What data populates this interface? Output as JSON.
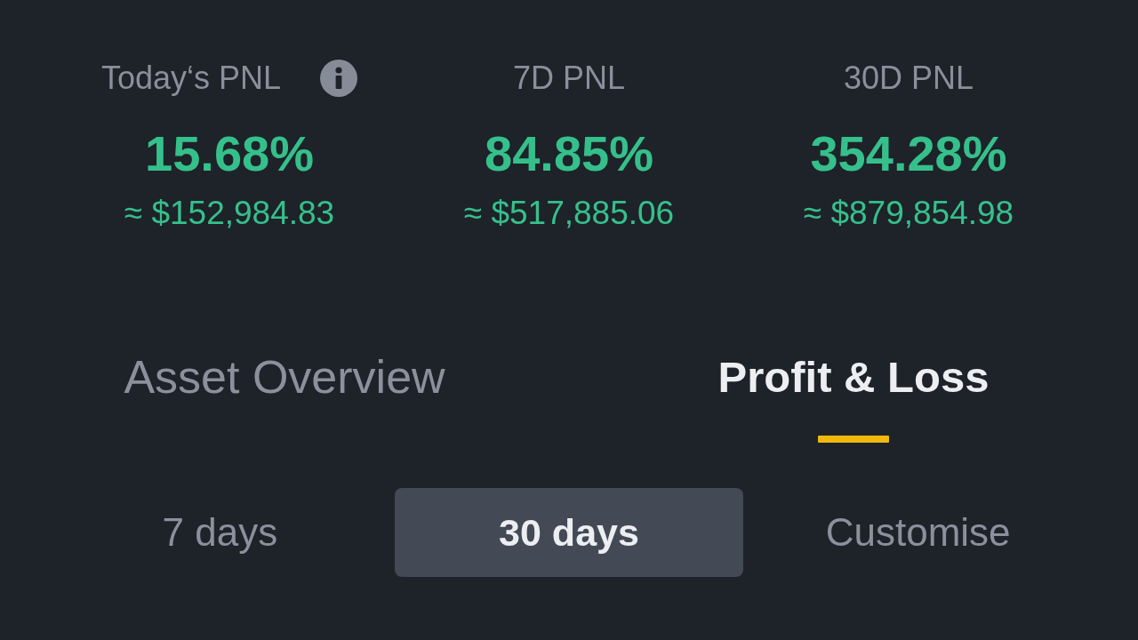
{
  "stats": [
    {
      "label": "Today‘s PNL",
      "has_info": true,
      "percent": "15.68%",
      "amount": "≈ $152,984.83"
    },
    {
      "label": "7D PNL",
      "has_info": false,
      "percent": "84.85%",
      "amount": "≈ $517,885.06"
    },
    {
      "label": "30D PNL",
      "has_info": false,
      "percent": "354.28%",
      "amount": "≈ $879,854.98"
    }
  ],
  "tabs": [
    {
      "label": "Asset Overview",
      "selected": false
    },
    {
      "label": "Profit & Loss",
      "selected": true
    }
  ],
  "periods": [
    {
      "label": "7 days",
      "selected": false
    },
    {
      "label": "30 days",
      "selected": true
    },
    {
      "label": "Customise",
      "selected": false
    }
  ]
}
